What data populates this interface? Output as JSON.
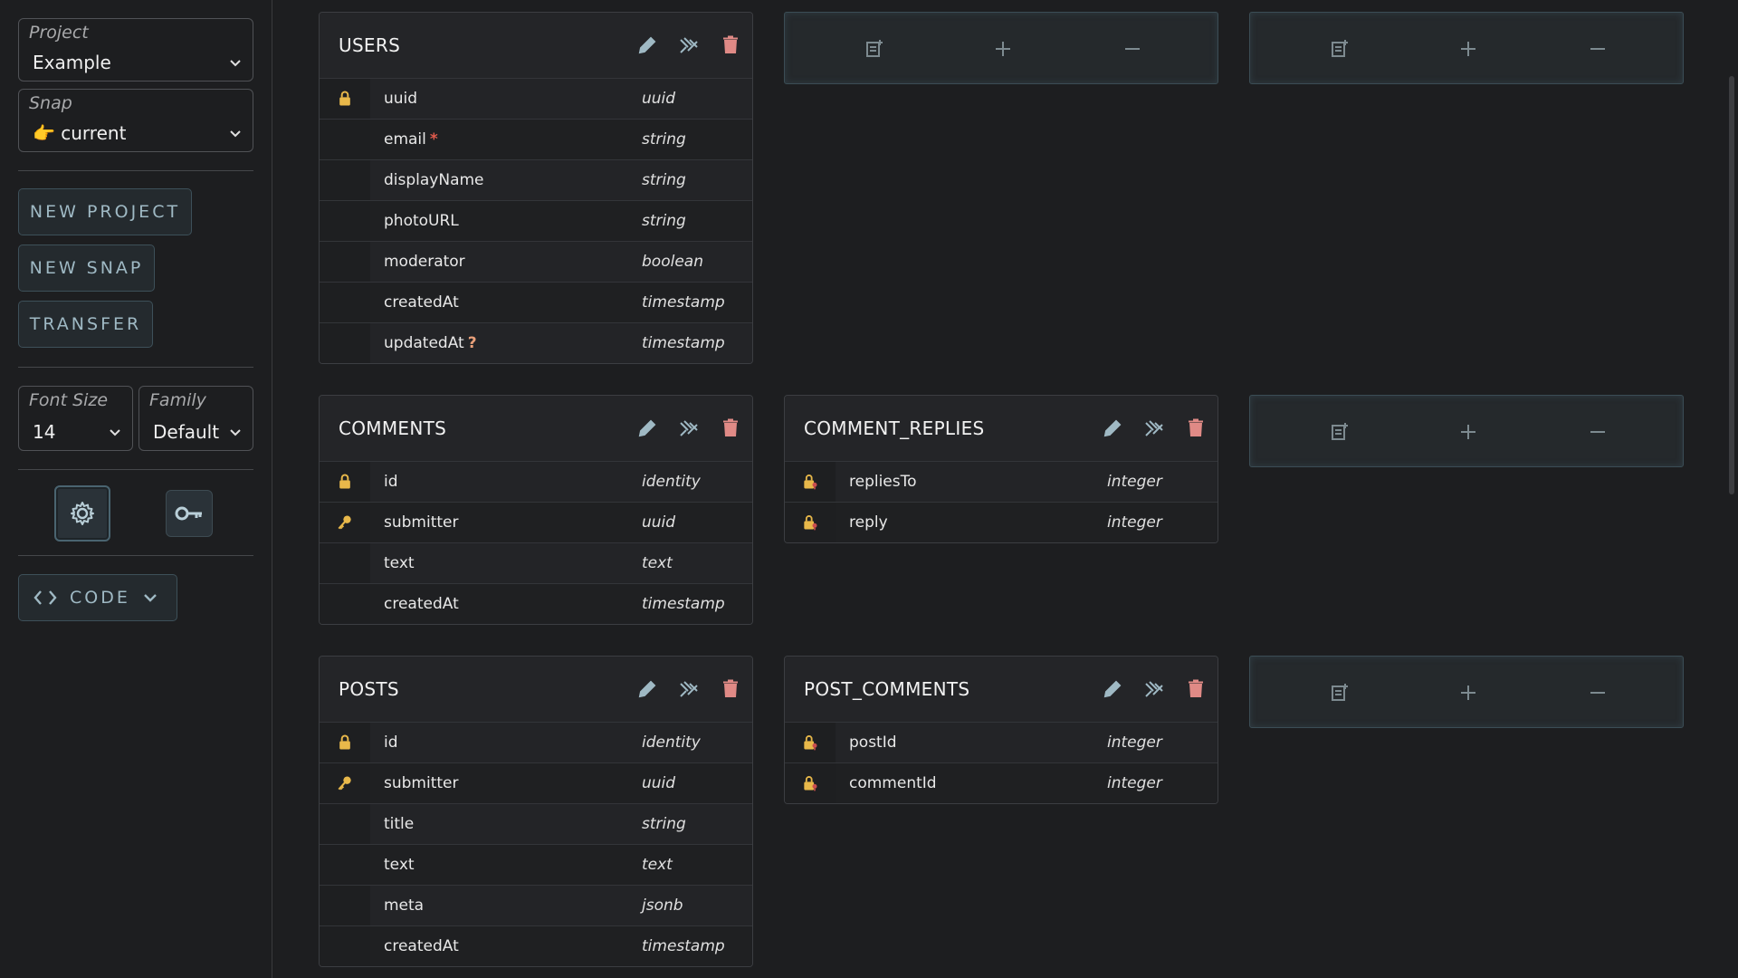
{
  "sidebar": {
    "project": {
      "label": "Project",
      "value": "Example"
    },
    "snap": {
      "label": "Snap",
      "value": "👉 current"
    },
    "buttons": {
      "new_project": "NEW PROJECT",
      "new_snap": "NEW SNAP",
      "transfer": "TRANSFER"
    },
    "font_size": {
      "label": "Font Size",
      "value": "14"
    },
    "family": {
      "label": "Family",
      "value": "Default"
    },
    "code_button": "CODE"
  },
  "tables": {
    "users": {
      "title": "USERS",
      "rows": [
        {
          "name": "uuid",
          "type": "uuid",
          "key": "primary"
        },
        {
          "name": "email",
          "type": "string",
          "mark": "*"
        },
        {
          "name": "displayName",
          "type": "string"
        },
        {
          "name": "photoURL",
          "type": "string"
        },
        {
          "name": "moderator",
          "type": "boolean"
        },
        {
          "name": "createdAt",
          "type": "timestamp"
        },
        {
          "name": "updatedAt",
          "type": "timestamp",
          "mark": "?"
        }
      ]
    },
    "comments": {
      "title": "COMMENTS",
      "rows": [
        {
          "name": "id",
          "type": "identity",
          "key": "primary"
        },
        {
          "name": "submitter",
          "type": "uuid",
          "key": "foreign"
        },
        {
          "name": "text",
          "type": "text"
        },
        {
          "name": "createdAt",
          "type": "timestamp"
        }
      ]
    },
    "comment_replies": {
      "title": "COMMENT_REPLIES",
      "rows": [
        {
          "name": "repliesTo",
          "type": "integer",
          "key": "composite"
        },
        {
          "name": "reply",
          "type": "integer",
          "key": "composite"
        }
      ]
    },
    "posts": {
      "title": "POSTS",
      "rows": [
        {
          "name": "id",
          "type": "identity",
          "key": "primary"
        },
        {
          "name": "submitter",
          "type": "uuid",
          "key": "foreign"
        },
        {
          "name": "title",
          "type": "string"
        },
        {
          "name": "text",
          "type": "text"
        },
        {
          "name": "meta",
          "type": "jsonb"
        },
        {
          "name": "createdAt",
          "type": "timestamp"
        }
      ]
    },
    "post_comments": {
      "title": "POST_COMMENTS",
      "rows": [
        {
          "name": "postId",
          "type": "integer",
          "key": "composite"
        },
        {
          "name": "commentId",
          "type": "integer",
          "key": "composite"
        }
      ]
    }
  },
  "colors": {
    "accent": "#9fb9c4",
    "delete": "#e08a86",
    "primary_key": "#e8b84a"
  }
}
